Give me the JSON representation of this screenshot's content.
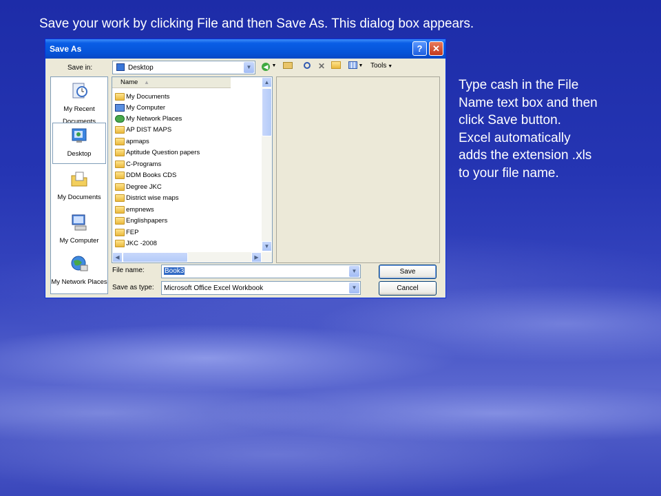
{
  "slide": {
    "caption": "Save your work by clicking File and then Save As. This dialog box appears.",
    "side_lines": [
      "Type cash in the File",
      "Name text box and then",
      "click Save button.",
      "Excel automatically",
      "adds the extension .xls",
      "to your file name."
    ]
  },
  "dialog": {
    "title": "Save As",
    "help_glyph": "?",
    "close_glyph": "✕",
    "save_in_label": "Save in:",
    "save_in_value": "Desktop",
    "tools_label": "Tools",
    "places": [
      {
        "label": "My Recent Documents",
        "icon": "recent-documents-icon"
      },
      {
        "label": "Desktop",
        "icon": "desktop-icon"
      },
      {
        "label": "My Documents",
        "icon": "my-documents-icon"
      },
      {
        "label": "My Computer",
        "icon": "my-computer-icon"
      },
      {
        "label": "My Network Places",
        "icon": "network-places-icon"
      }
    ],
    "column_name": "Name",
    "files": [
      "My Documents",
      "My Computer",
      "My Network Places",
      "AP DIST MAPS",
      "apmaps",
      "Aptitude Question papers",
      "C-Programs",
      "DDM Books CDS",
      "Degree JKC",
      "District wise maps",
      "empnews",
      "Englishpapers",
      "FEP",
      "JKC -2008"
    ],
    "file_name_label": "File name:",
    "file_name_value": "Book3",
    "save_type_label": "Save as type:",
    "save_type_value": "Microsoft Office Excel Workbook",
    "save_button": "Save",
    "cancel_button": "Cancel"
  }
}
